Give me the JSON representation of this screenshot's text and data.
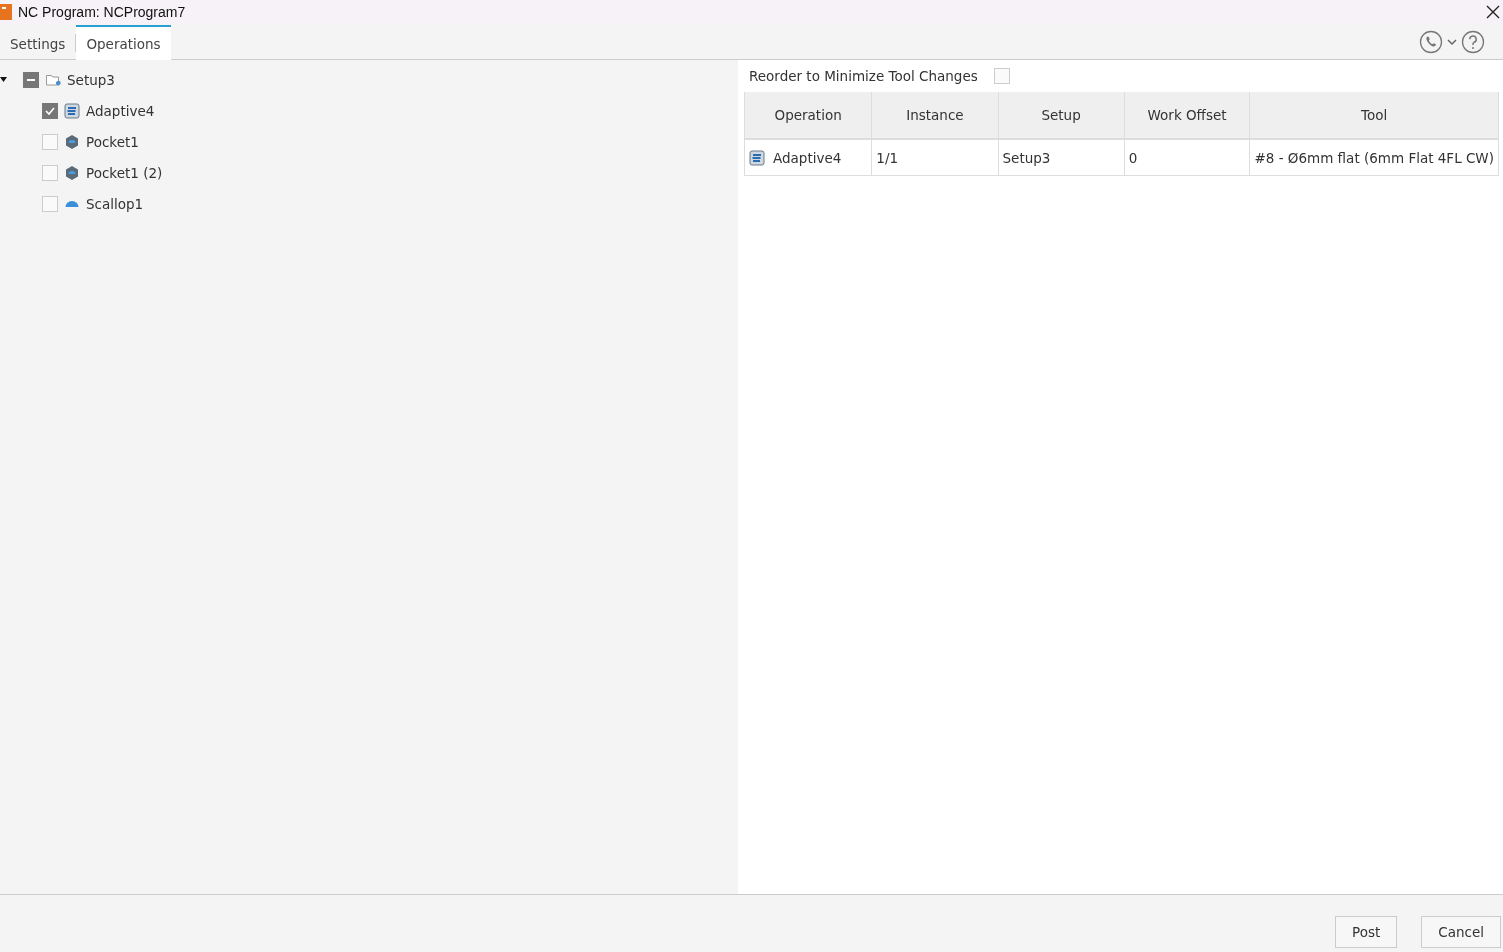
{
  "window": {
    "title": "NC Program: NCProgram7"
  },
  "tabs": [
    {
      "label": "Settings",
      "selected": false
    },
    {
      "label": "Operations",
      "selected": true
    }
  ],
  "tree": [
    {
      "label": "Setup3",
      "kind": "setup",
      "expanded": true,
      "indeterminate": true,
      "children": [
        {
          "label": "Adaptive4",
          "kind": "adaptive",
          "checked": true
        },
        {
          "label": "Pocket1",
          "kind": "pocket",
          "checked": false
        },
        {
          "label": "Pocket1 (2)",
          "kind": "pocket",
          "checked": false
        },
        {
          "label": "Scallop1",
          "kind": "scallop",
          "checked": false
        }
      ]
    }
  ],
  "reorder": {
    "label": "Reorder to Minimize Tool Changes",
    "checked": false
  },
  "table": {
    "columns": [
      "Operation",
      "Instance",
      "Setup",
      "Work Offset",
      "Tool"
    ],
    "rows": [
      {
        "kind": "adaptive",
        "cells": [
          "Adaptive4",
          "1/1",
          "Setup3",
          "0",
          "#8 - Ø6mm flat (6mm Flat 4FL CW)"
        ]
      }
    ]
  },
  "buttons": [
    "Post",
    "Cancel"
  ]
}
